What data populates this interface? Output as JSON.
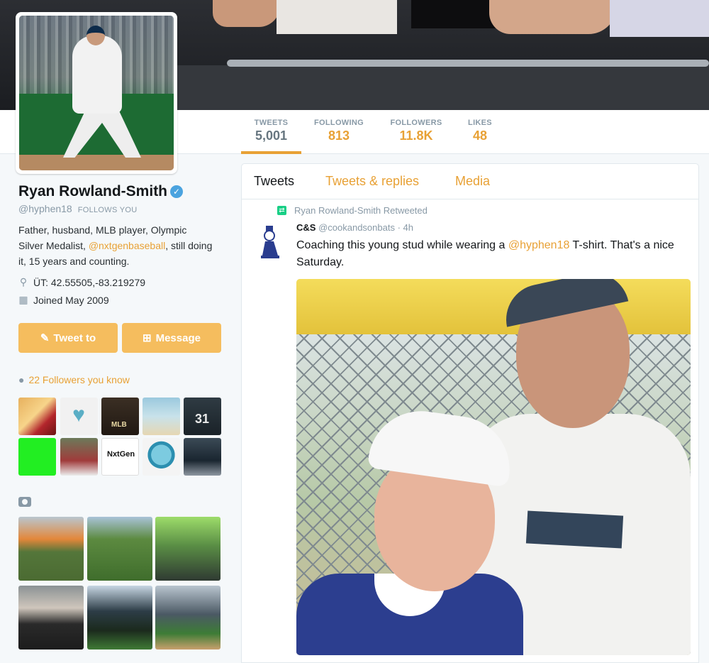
{
  "profile": {
    "name": "Ryan Rowland-Smith",
    "handle": "@hyphen18",
    "follows_you": "FOLLOWS YOU",
    "bio_part1": "Father, husband, MLB player, Olympic Silver Medalist, ",
    "bio_link": "@nxtgenbaseball",
    "bio_part2": ", still doing it, 15 years and counting.",
    "location": "ÜT: 42.55505,-83.219279",
    "joined": "Joined May 2009",
    "tweet_to": "Tweet to",
    "message": "Message",
    "followers_you_know": "22 Followers you know"
  },
  "stats": {
    "tweets_label": "TWEETS",
    "tweets_value": "5,001",
    "following_label": "FOLLOWING",
    "following_value": "813",
    "followers_label": "FOLLOWERS",
    "followers_value": "11.8K",
    "likes_label": "LIKES",
    "likes_value": "48"
  },
  "timeline": {
    "tabs": [
      "Tweets",
      "Tweets & replies",
      "Media"
    ],
    "retweet_note": "Ryan Rowland-Smith Retweeted",
    "tweet_author": "C&S",
    "tweet_handle": "@cookandsonbats",
    "tweet_time": "· 4h",
    "tweet_text_1": "Coaching this young stud while wearing a ",
    "tweet_mention": "@hyphen18",
    "tweet_text_2": " T-shirt.  That's a nice Saturday."
  },
  "thumb_labels": {
    "mlb": "MLB",
    "nxtgen": "NxtGen",
    "number": "31"
  },
  "colors": {
    "accent": "#e8a135",
    "button": "#f5bd5e",
    "retweet": "#19cf86",
    "verified": "#4aa3df"
  }
}
